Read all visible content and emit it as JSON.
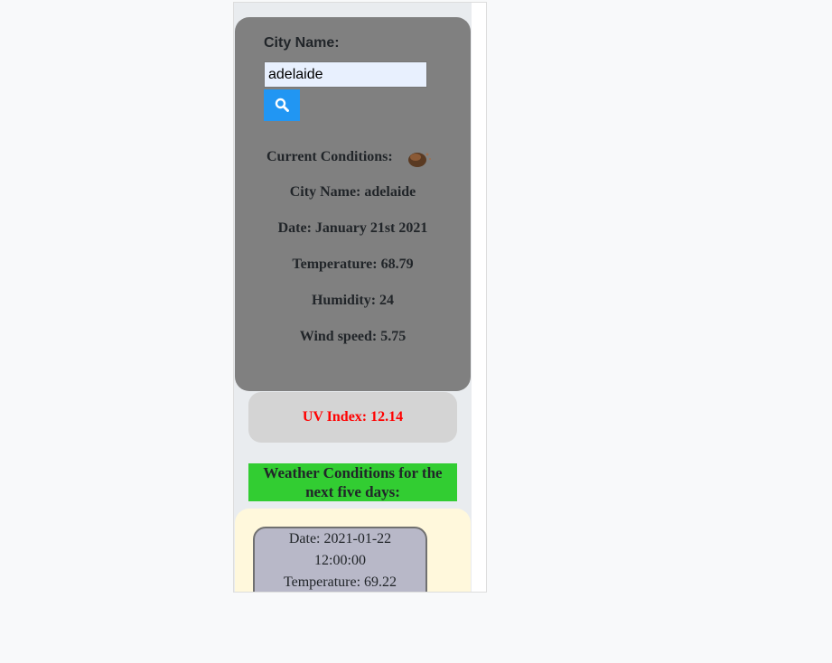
{
  "search": {
    "label": "City Name:",
    "value": "adelaide",
    "button_icon": "search-icon"
  },
  "current": {
    "title": "Current Conditions:",
    "icon": "weather-icon",
    "city": "City Name: adelaide",
    "date": "Date: January 21st 2021",
    "temperature": "Temperature: 68.79",
    "humidity": "Humidity: 24",
    "wind": "Wind speed: 5.75"
  },
  "uv": {
    "text": "UV Index: 12.14",
    "color": "#ff0000"
  },
  "forecast": {
    "header": "Weather Conditions for the next five days:",
    "days": [
      {
        "date_line1": "Date: 2021-01-22",
        "date_line2": "12:00:00",
        "temperature": "Temperature: 69.22"
      }
    ]
  },
  "colors": {
    "search_panel": "#808080",
    "search_button": "#2196f3",
    "uv_panel": "#d4d4d4",
    "forecast_header": "#32cd32",
    "forecast_panel": "#fff8dc",
    "forecast_card": "#b8b8c8"
  }
}
